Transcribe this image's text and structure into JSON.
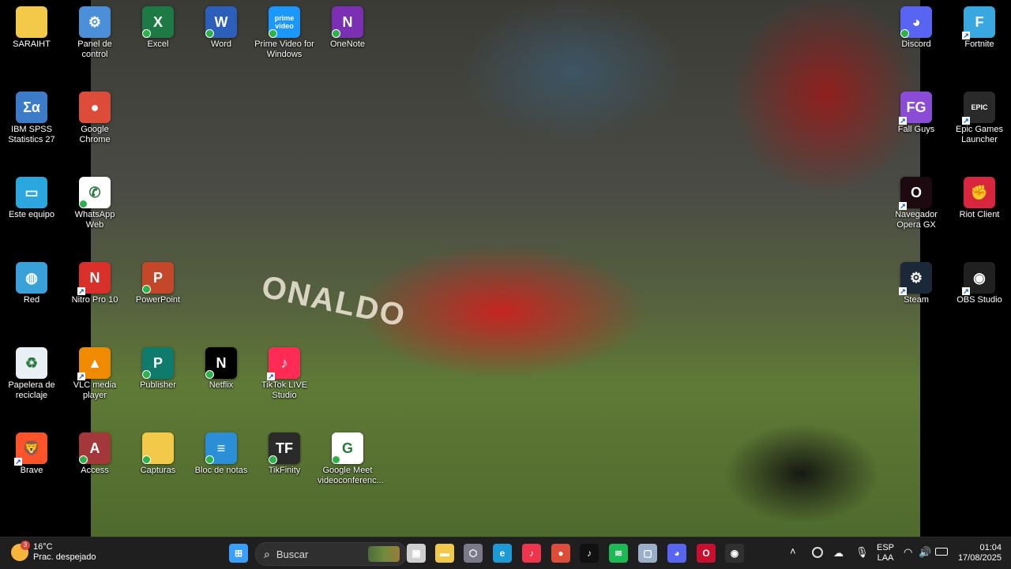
{
  "desktop": {
    "icons": [
      {
        "id": "saraiht",
        "label": "SARAIHT",
        "icon": "folder-icon",
        "glyph": "",
        "color": "#f3c94a",
        "badge": false,
        "shortcut": false
      },
      {
        "id": "panel-de-control",
        "label": "Panel de control",
        "icon": "control-panel-icon",
        "glyph": "⚙",
        "color": "#4a8fd8",
        "badge": false,
        "shortcut": false
      },
      {
        "id": "excel",
        "label": "Excel",
        "icon": "excel-icon",
        "glyph": "X",
        "color": "#1d7a45",
        "badge": true,
        "shortcut": false
      },
      {
        "id": "word",
        "label": "Word",
        "icon": "word-icon",
        "glyph": "W",
        "color": "#2b5fb9",
        "badge": true,
        "shortcut": false
      },
      {
        "id": "prime-video",
        "label": "Prime Video for Windows",
        "icon": "prime-video-icon",
        "glyph": "prime video",
        "color": "#1a98ff",
        "badge": true,
        "shortcut": false
      },
      {
        "id": "onenote",
        "label": "OneNote",
        "icon": "onenote-icon",
        "glyph": "N",
        "color": "#7b2fb3",
        "badge": true,
        "shortcut": false
      },
      {
        "id": "discord",
        "label": "Discord",
        "icon": "discord-icon",
        "glyph": "◕",
        "color": "#5865f2",
        "badge": true,
        "shortcut": false
      },
      {
        "id": "fortnite",
        "label": "Fortnite",
        "icon": "fortnite-icon",
        "glyph": "F",
        "color": "#3aa8e0",
        "badge": false,
        "shortcut": true
      },
      {
        "id": "ibm-spss",
        "label": "IBM SPSS Statistics 27",
        "icon": "spss-icon",
        "glyph": "Σα",
        "color": "#3b7bc8",
        "badge": false,
        "shortcut": false
      },
      {
        "id": "google-chrome",
        "label": "Google Chrome",
        "icon": "chrome-icon",
        "glyph": "●",
        "color": "#dd4b39",
        "badge": false,
        "shortcut": false
      },
      {
        "id": "fall-guys",
        "label": "Fall Guys",
        "icon": "fall-guys-icon",
        "glyph": "FG",
        "color": "#8a4bd6",
        "badge": false,
        "shortcut": true
      },
      {
        "id": "epic-games",
        "label": "Epic Games Launcher",
        "icon": "epic-games-icon",
        "glyph": "EPIC",
        "color": "#2a2a2a",
        "badge": false,
        "shortcut": true
      },
      {
        "id": "este-equipo",
        "label": "Este equipo",
        "icon": "computer-icon",
        "glyph": "▭",
        "color": "#2aa7de",
        "badge": false,
        "shortcut": false
      },
      {
        "id": "whatsapp-web",
        "label": "WhatsApp Web",
        "icon": "whatsapp-icon",
        "glyph": "✆",
        "color": "#ffffff",
        "badge": true,
        "shortcut": false
      },
      {
        "id": "opera-gx",
        "label": "Navegador Opera GX",
        "icon": "opera-gx-icon",
        "glyph": "O",
        "color": "#1c0a10",
        "badge": false,
        "shortcut": true
      },
      {
        "id": "riot-client",
        "label": "Riot Client",
        "icon": "riot-client-icon",
        "glyph": "✊",
        "color": "#d7263d",
        "badge": false,
        "shortcut": false
      },
      {
        "id": "red",
        "label": "Red",
        "icon": "network-icon",
        "glyph": "◍",
        "color": "#3aa0d8",
        "badge": false,
        "shortcut": false
      },
      {
        "id": "nitro-pro",
        "label": "Nitro Pro 10",
        "icon": "nitro-pro-icon",
        "glyph": "N",
        "color": "#d9302b",
        "badge": false,
        "shortcut": true
      },
      {
        "id": "powerpoint",
        "label": "PowerPoint",
        "icon": "powerpoint-icon",
        "glyph": "P",
        "color": "#c4472a",
        "badge": true,
        "shortcut": false
      },
      {
        "id": "steam",
        "label": "Steam",
        "icon": "steam-icon",
        "glyph": "⚙",
        "color": "#1b2838",
        "badge": false,
        "shortcut": true
      },
      {
        "id": "obs-studio",
        "label": "OBS Studio",
        "icon": "obs-studio-icon",
        "glyph": "◉",
        "color": "#202020",
        "badge": false,
        "shortcut": true
      },
      {
        "id": "papelera",
        "label": "Papelera de reciclaje",
        "icon": "recycle-bin-icon",
        "glyph": "♻",
        "color": "#e8f0f6",
        "badge": false,
        "shortcut": false
      },
      {
        "id": "vlc",
        "label": "VLC media player",
        "icon": "vlc-icon",
        "glyph": "▲",
        "color": "#f08a00",
        "badge": false,
        "shortcut": true
      },
      {
        "id": "publisher",
        "label": "Publisher",
        "icon": "publisher-icon",
        "glyph": "P",
        "color": "#0f7b6c",
        "badge": true,
        "shortcut": false
      },
      {
        "id": "netflix",
        "label": "Netflix",
        "icon": "netflix-icon",
        "glyph": "N",
        "color": "#000000",
        "badge": true,
        "shortcut": false
      },
      {
        "id": "tiktok-live",
        "label": "TikTok LIVE Studio",
        "icon": "tiktok-live-icon",
        "glyph": "♪",
        "color": "#fe2c55",
        "badge": false,
        "shortcut": true
      },
      {
        "id": "brave",
        "label": "Brave",
        "icon": "brave-icon",
        "glyph": "🦁",
        "color": "#fb542b",
        "badge": false,
        "shortcut": true
      },
      {
        "id": "access",
        "label": "Access",
        "icon": "access-icon",
        "glyph": "A",
        "color": "#a4373a",
        "badge": true,
        "shortcut": false
      },
      {
        "id": "capturas",
        "label": "Capturas",
        "icon": "folder-icon",
        "glyph": "",
        "color": "#f3c94a",
        "badge": true,
        "shortcut": false
      },
      {
        "id": "bloc-de-notas",
        "label": "Bloc de notas",
        "icon": "notepad-icon",
        "glyph": "≡",
        "color": "#2a8fd6",
        "badge": true,
        "shortcut": false
      },
      {
        "id": "tikfinity",
        "label": "TikFinity",
        "icon": "tikfinity-icon",
        "glyph": "TF",
        "color": "#2a2a2a",
        "badge": true,
        "shortcut": false
      },
      {
        "id": "google-meet",
        "label": "Google Meet videoconferenc...",
        "icon": "google-icon",
        "glyph": "G",
        "color": "#ffffff",
        "badge": true,
        "shortcut": false
      }
    ]
  },
  "wallpaper": {
    "jersey_text": "ONALDO"
  },
  "taskbar": {
    "weather": {
      "temp": "16°C",
      "desc": "Prac. despejado",
      "notif": "3"
    },
    "search_placeholder": "Buscar",
    "apps": [
      {
        "id": "start",
        "icon": "windows-start-icon",
        "glyph": "⊞",
        "color": "#3aa0ff"
      },
      {
        "id": "task-view",
        "icon": "task-view-icon",
        "glyph": "▣",
        "color": "#cfcfcf"
      },
      {
        "id": "file-explorer",
        "icon": "file-explorer-icon",
        "glyph": "▬",
        "color": "#f3c94a"
      },
      {
        "id": "app-3d",
        "icon": "box-app-icon",
        "glyph": "⬡",
        "color": "#7a7a8a"
      },
      {
        "id": "edge",
        "icon": "edge-icon",
        "glyph": "e",
        "color": "#1c9ad6"
      },
      {
        "id": "music",
        "icon": "music-icon",
        "glyph": "♪",
        "color": "#f0344d"
      },
      {
        "id": "chrome",
        "icon": "chrome-icon",
        "glyph": "●",
        "color": "#dd4b39"
      },
      {
        "id": "tiktok",
        "icon": "tiktok-icon",
        "glyph": "♪",
        "color": "#111111"
      },
      {
        "id": "spotify",
        "icon": "spotify-icon",
        "glyph": "≋",
        "color": "#1db954"
      },
      {
        "id": "app-box",
        "icon": "generic-app-icon",
        "glyph": "▢",
        "color": "#9ab0c8"
      },
      {
        "id": "discord",
        "icon": "discord-icon",
        "glyph": "◕",
        "color": "#5865f2"
      },
      {
        "id": "opera",
        "icon": "opera-icon",
        "glyph": "O",
        "color": "#c8102e"
      },
      {
        "id": "obs",
        "icon": "obs-icon",
        "glyph": "◉",
        "color": "#303030"
      }
    ],
    "tray": {
      "language": "ESP",
      "layout": "LAA",
      "time": "01:04",
      "date": "17/08/2025"
    }
  }
}
